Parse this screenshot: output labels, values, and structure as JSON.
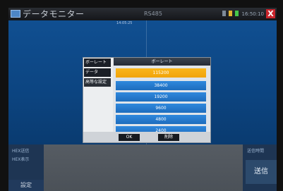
{
  "title_bar": {
    "title": "データモニター",
    "mode": "RS485",
    "status": "16:50:10",
    "close_label": "X"
  },
  "data_area": {
    "address_text": "14:05:25"
  },
  "bottom": {
    "hex_send_label": "HEX送信",
    "hex_display_label": "HEX表示",
    "settings_label": "設定",
    "send_time_label": "送信時間",
    "send_label": "送信"
  },
  "dialog": {
    "side_items": [
      "ボーレート",
      "データ",
      "高等な設定"
    ],
    "header": "ボーレート",
    "options": [
      "115200",
      "38400",
      "19200",
      "9600",
      "4800",
      "2400"
    ],
    "selected_index": 0,
    "ok_label": "OK",
    "delete_label": "削除"
  },
  "colors": {
    "selected": "#f5ac12",
    "option": "#2179cd",
    "close": "#c8252c"
  }
}
